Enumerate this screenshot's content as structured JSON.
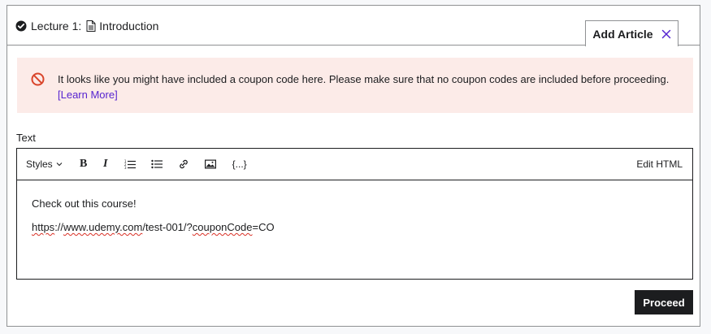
{
  "header": {
    "lecture_label": "Lecture 1:",
    "lecture_title": "Introduction",
    "tab_label": "Add Article"
  },
  "alert": {
    "message": "It looks like you might have included a coupon code here. Please make sure that no coupon codes are included before proceeding.",
    "link_text": "[Learn More]",
    "color": "#fcebe8",
    "icon_color": "#d9452b"
  },
  "editor": {
    "label": "Text",
    "toolbar": {
      "styles_label": "Styles",
      "bold_label": "B",
      "italic_label": "I",
      "code_label": "{...}",
      "edit_html_label": "Edit HTML",
      "icons": [
        "numbered-list-icon",
        "bullet-list-icon",
        "link-icon",
        "image-icon"
      ]
    },
    "content": {
      "line1": "Check out this course!",
      "url_part1": "https",
      "url_part2": "://",
      "url_part3": "www.udemy.com",
      "url_part4": "/test-001/?",
      "url_part5": "couponCode",
      "url_part6": "=CO"
    }
  },
  "actions": {
    "proceed_label": "Proceed"
  },
  "colors": {
    "accent": "#5624d0",
    "dark": "#1c1d1f",
    "border": "#8f9193"
  }
}
